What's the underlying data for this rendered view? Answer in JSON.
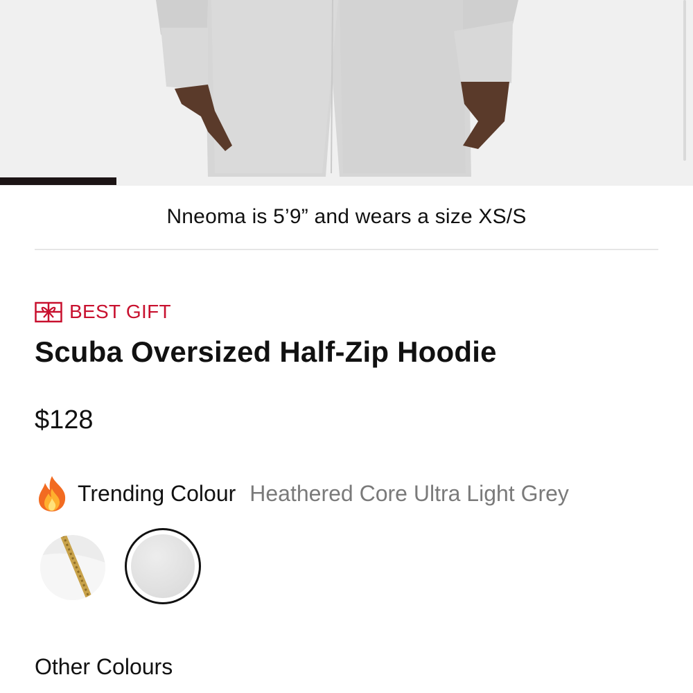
{
  "product_image": {
    "icon": "product-photo",
    "carousel_progress": 0.168
  },
  "model_caption": "Nneoma is 5’9” and wears a size XS/S",
  "badge": {
    "icon": "gift-icon",
    "label": "BEST GIFT",
    "color": "#c8102e"
  },
  "product": {
    "title": "Scuba Oversized Half-Zip Hoodie",
    "price": "$128"
  },
  "colour": {
    "icon": "fire-icon",
    "label": "Trending Colour",
    "selected": "Heathered Core Ultra Light Grey",
    "swatches": [
      {
        "icon": "zipper-swatch",
        "selected": false
      },
      {
        "icon": "heathered-grey-swatch",
        "selected": true
      }
    ]
  },
  "other_colours_label": "Other Colours"
}
